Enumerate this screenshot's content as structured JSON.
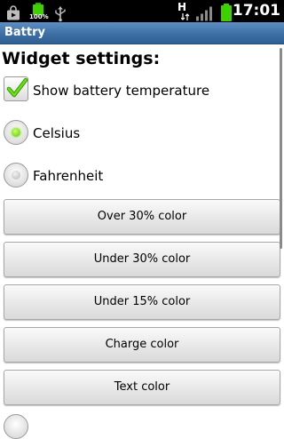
{
  "status_bar": {
    "time": "17:01",
    "battery_percent_label": "100%",
    "network_type": "H",
    "icons": [
      "play-store-icon",
      "battery-widget-icon",
      "usb-icon",
      "network-h-icon",
      "signal-icon",
      "battery-icon"
    ]
  },
  "title_bar": {
    "title": "Battry"
  },
  "settings": {
    "heading": "Widget settings:",
    "show_temperature": {
      "label": "Show battery temperature",
      "checked": true
    },
    "units": [
      {
        "label": "Celsius",
        "selected": true
      },
      {
        "label": "Fahrenheit",
        "selected": false
      }
    ],
    "buttons": [
      {
        "label": "Over 30% color"
      },
      {
        "label": "Under 30% color"
      },
      {
        "label": "Under 15% color"
      },
      {
        "label": "Charge color"
      },
      {
        "label": "Text color"
      }
    ]
  },
  "colors": {
    "accent_green": "#58c800",
    "title_bar_blue": "#3e6fa4"
  }
}
